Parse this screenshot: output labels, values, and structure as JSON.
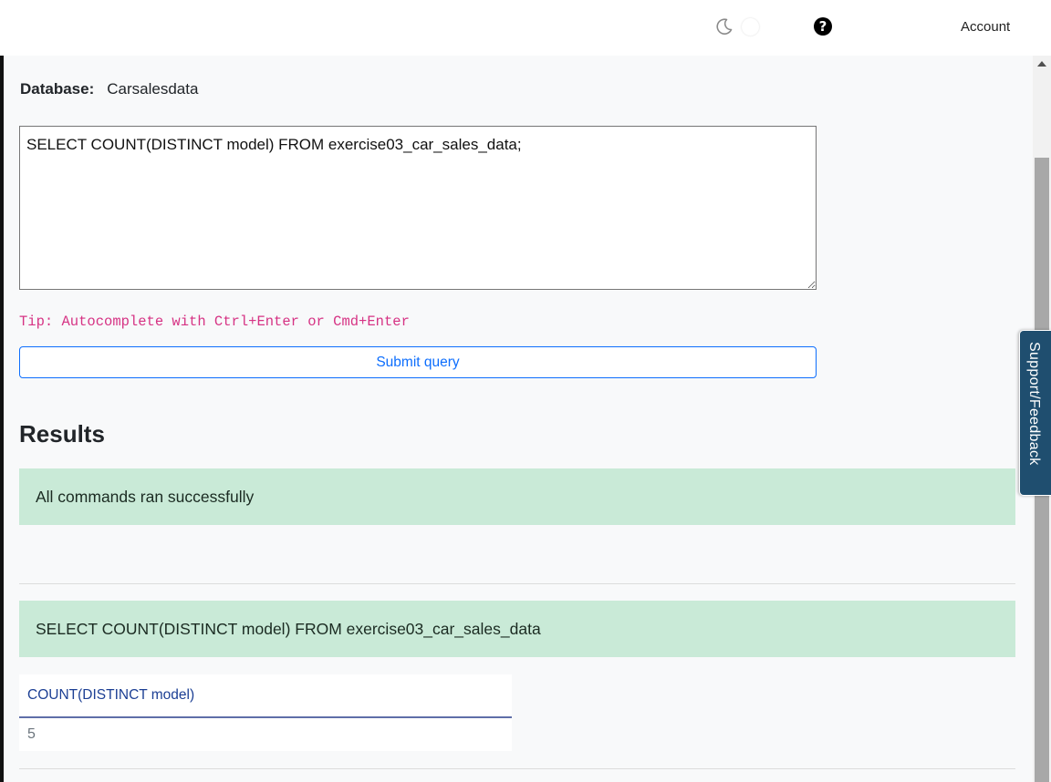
{
  "header": {
    "help_icon_glyph": "?",
    "account_label": "Account"
  },
  "database": {
    "label": "Database:",
    "name": "Carsalesdata"
  },
  "editor": {
    "query_text": "SELECT COUNT(DISTINCT model) FROM exercise03_car_sales_data;"
  },
  "tip": "Tip: Autocomplete with Ctrl+Enter or Cmd+Enter",
  "submit_label": "Submit query",
  "results": {
    "title": "Results",
    "status_message": "All commands ran successfully",
    "executed_query": "SELECT COUNT(DISTINCT model) FROM exercise03_car_sales_data",
    "table": {
      "columns": [
        "COUNT(DISTINCT model)"
      ],
      "rows": [
        [
          "5"
        ]
      ]
    }
  },
  "feedback_tab_label": "Support/Feedback",
  "colors": {
    "accent": "#0d6efd",
    "tip": "#d63384",
    "success_bg": "#c9ead7",
    "feedback_bg": "#1f4e6f"
  },
  "icons": [
    "moon-icon",
    "theme-toggle",
    "help-icon"
  ]
}
